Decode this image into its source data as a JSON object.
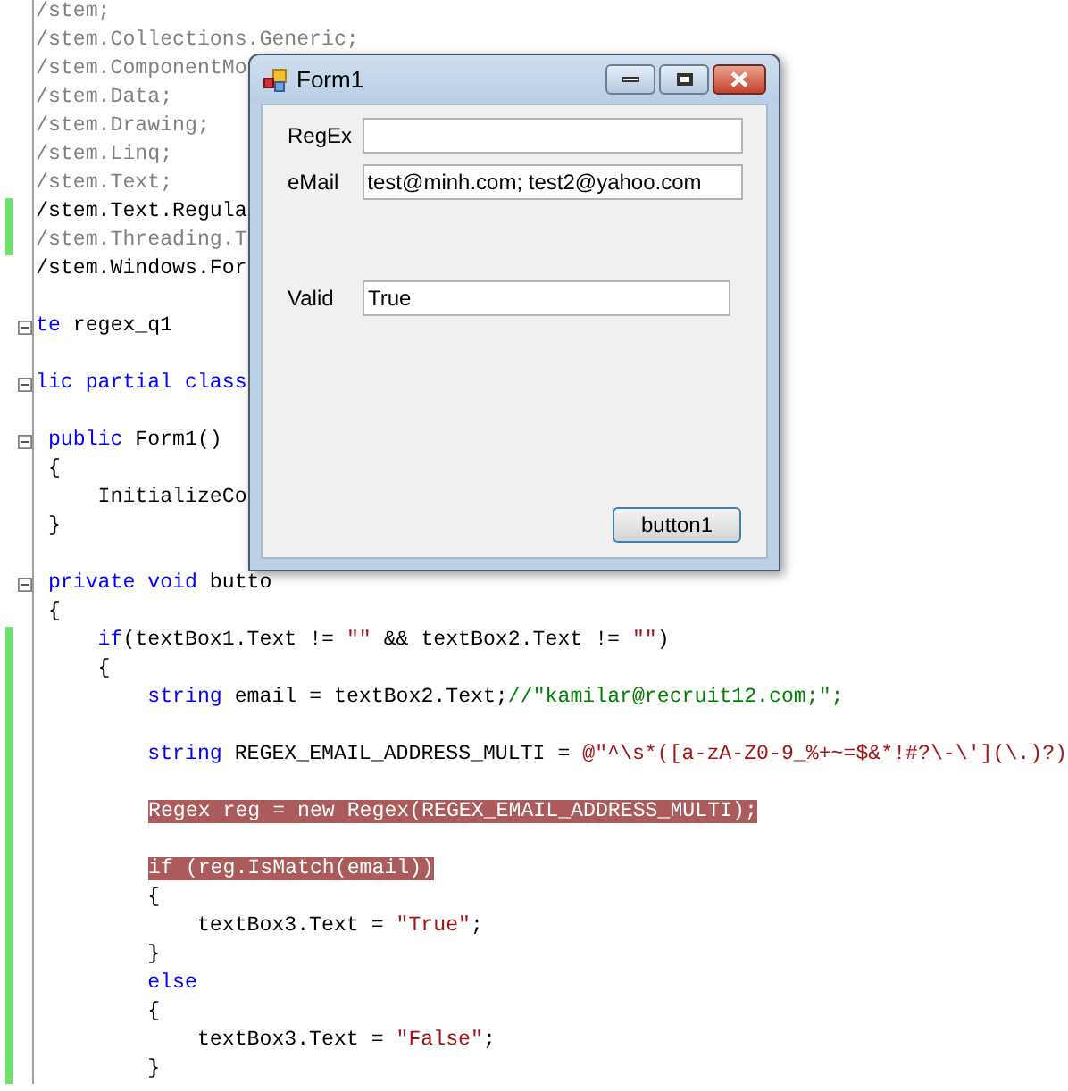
{
  "code_lines": [
    {
      "changed": false,
      "fold": false,
      "segments": [
        {
          "t": "/stem;",
          "kind": "dim"
        }
      ]
    },
    {
      "changed": false,
      "fold": false,
      "segments": [
        {
          "t": "/stem.Collections.Generic;",
          "kind": "dim"
        }
      ]
    },
    {
      "changed": false,
      "fold": false,
      "segments": [
        {
          "t": "/stem.ComponentMo",
          "kind": "dim"
        }
      ]
    },
    {
      "changed": false,
      "fold": false,
      "segments": [
        {
          "t": "/stem.Data;",
          "kind": "dim"
        }
      ]
    },
    {
      "changed": false,
      "fold": false,
      "segments": [
        {
          "t": "/stem.Drawing;",
          "kind": "dim"
        }
      ]
    },
    {
      "changed": false,
      "fold": false,
      "segments": [
        {
          "t": "/stem.Linq;",
          "kind": "dim"
        }
      ]
    },
    {
      "changed": false,
      "fold": false,
      "segments": [
        {
          "t": "/stem.Text;",
          "kind": "dim"
        }
      ]
    },
    {
      "changed": true,
      "fold": false,
      "segments": [
        {
          "t": "/stem.Text.Regula",
          "kind": "plain"
        }
      ]
    },
    {
      "changed": true,
      "fold": false,
      "segments": [
        {
          "t": "/stem.Threading.T",
          "kind": "dim"
        }
      ]
    },
    {
      "changed": false,
      "fold": false,
      "segments": [
        {
          "t": "/stem.Windows.For",
          "kind": "plain"
        }
      ]
    },
    {
      "changed": false,
      "fold": false
    },
    {
      "changed": false,
      "fold": true,
      "segments": [
        {
          "t": "te",
          "kind": "keyword"
        },
        {
          "t": " regex_q1",
          "kind": "plain"
        }
      ]
    },
    {
      "changed": false,
      "fold": false
    },
    {
      "changed": false,
      "fold": true,
      "segments": [
        {
          "t": "lic partial class",
          "kind": "keyword"
        }
      ]
    },
    {
      "changed": false,
      "fold": false
    },
    {
      "changed": false,
      "fold": true,
      "segments": [
        {
          "t": " public",
          "kind": "keyword"
        },
        {
          "t": " Form1()",
          "kind": "plain"
        }
      ]
    },
    {
      "changed": false,
      "fold": false,
      "segments": [
        {
          "t": " {",
          "kind": "plain"
        }
      ]
    },
    {
      "changed": false,
      "fold": false,
      "segments": [
        {
          "t": "     InitializeCo",
          "kind": "plain"
        }
      ]
    },
    {
      "changed": false,
      "fold": false,
      "segments": [
        {
          "t": " }",
          "kind": "plain"
        }
      ]
    },
    {
      "changed": false,
      "fold": false
    },
    {
      "changed": false,
      "fold": true,
      "segments": [
        {
          "t": " private void",
          "kind": "keyword"
        },
        {
          "t": " butto",
          "kind": "plain"
        }
      ]
    },
    {
      "changed": false,
      "fold": false,
      "segments": [
        {
          "t": " {",
          "kind": "plain"
        }
      ]
    },
    {
      "changed": true,
      "fold": false,
      "segments": [
        {
          "t": "     if",
          "kind": "keyword"
        },
        {
          "t": "(textBox1.Text != ",
          "kind": "plain"
        },
        {
          "t": "\"\"",
          "kind": "string"
        },
        {
          "t": " && textBox2.Text != ",
          "kind": "plain"
        },
        {
          "t": "\"\"",
          "kind": "string"
        },
        {
          "t": ")",
          "kind": "plain"
        }
      ]
    },
    {
      "changed": true,
      "fold": false,
      "segments": [
        {
          "t": "     {",
          "kind": "plain"
        }
      ]
    },
    {
      "changed": true,
      "fold": false,
      "segments": [
        {
          "t": "         string",
          "kind": "keyword"
        },
        {
          "t": " email = textBox2.Text;",
          "kind": "plain"
        },
        {
          "t": "//\"kamilar@recruit12.com;\";",
          "kind": "comment"
        }
      ]
    },
    {
      "changed": true,
      "fold": false
    },
    {
      "changed": true,
      "fold": false,
      "segments": [
        {
          "t": "         string",
          "kind": "keyword"
        },
        {
          "t": " REGEX_EMAIL_ADDRESS_MULTI = ",
          "kind": "plain"
        },
        {
          "t": "@\"^\\s*([a-zA-Z0-9_%+~=$&*!#?\\-\\'](\\.)?)",
          "kind": "string"
        }
      ]
    },
    {
      "changed": true,
      "fold": false
    },
    {
      "changed": true,
      "fold": false,
      "segments": [
        {
          "t": "Regex reg = new Regex(REGEX_EMAIL_ADDRESS_MULTI);",
          "kind": "highlight"
        }
      ]
    },
    {
      "changed": true,
      "fold": false
    },
    {
      "changed": true,
      "fold": false,
      "segments": [
        {
          "t": "if (reg.IsMatch(email))",
          "kind": "highlight"
        }
      ]
    },
    {
      "changed": true,
      "fold": false,
      "segments": [
        {
          "t": "         {",
          "kind": "plain"
        }
      ]
    },
    {
      "changed": true,
      "fold": false,
      "segments": [
        {
          "t": "             textBox3.Text = ",
          "kind": "plain"
        },
        {
          "t": "\"True\"",
          "kind": "string"
        },
        {
          "t": ";",
          "kind": "plain"
        }
      ]
    },
    {
      "changed": true,
      "fold": false,
      "segments": [
        {
          "t": "         }",
          "kind": "plain"
        }
      ]
    },
    {
      "changed": true,
      "fold": false,
      "segments": [
        {
          "t": "         else",
          "kind": "keyword"
        }
      ]
    },
    {
      "changed": true,
      "fold": false,
      "segments": [
        {
          "t": "         {",
          "kind": "plain"
        }
      ]
    },
    {
      "changed": true,
      "fold": false,
      "segments": [
        {
          "t": "             textBox3.Text = ",
          "kind": "plain"
        },
        {
          "t": "\"False\"",
          "kind": "string"
        },
        {
          "t": ";",
          "kind": "plain"
        }
      ]
    },
    {
      "changed": true,
      "fold": false,
      "segments": [
        {
          "t": "         }",
          "kind": "plain"
        }
      ]
    }
  ],
  "form": {
    "title": "Form1",
    "fields": [
      {
        "label": "RegEx"
      },
      {
        "label": "eMail",
        "value": "test@minh.com; test2@yahoo.com"
      },
      {
        "label": "Valid",
        "value": "True"
      }
    ],
    "button": "button1"
  }
}
